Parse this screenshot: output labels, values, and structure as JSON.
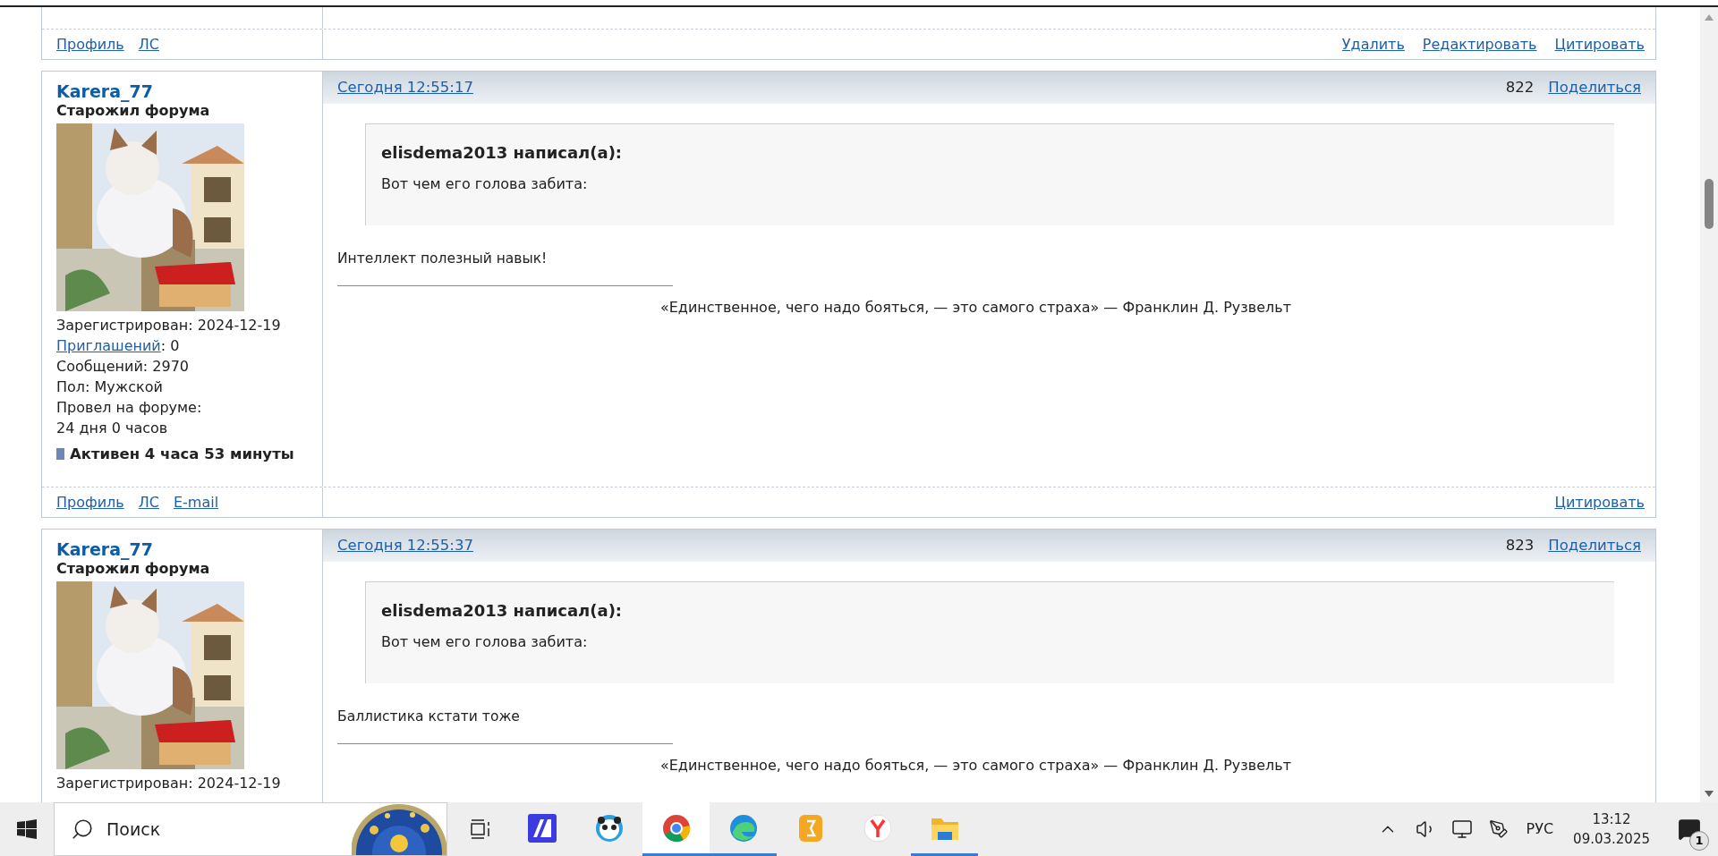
{
  "previous_post_footer": {
    "left_links": [
      "Профиль",
      "ЛС"
    ],
    "right_links": [
      "Удалить",
      "Редактировать",
      "Цитировать"
    ]
  },
  "posts": [
    {
      "author": "Karera_77",
      "rank": "Старожил форума",
      "joined": "Зарегистрирован: 2024-12-19",
      "invites_link": "Приглашений",
      "invites_value": ": 0",
      "messages": "Сообщений: 2970",
      "gender": "Пол: Мужской",
      "time_label": "Провел на форуме:",
      "time_value": "24 дня 0 часов",
      "active": "Активен 4 часа 53 минуты",
      "date": "Сегодня 12:55:17",
      "number": "822",
      "share": "Поделиться",
      "quote": {
        "author_line": "elisdema2013 написал(а):",
        "text": "Вот чем его голова забита:"
      },
      "body": "Интеллект полезный навык!",
      "signature": "«Единственное, чего надо бояться, — это самого страха» — Франклин Д. Рузвельт",
      "footer_left": [
        "Профиль",
        "ЛС",
        "E-mail"
      ],
      "footer_right": [
        "Цитировать"
      ]
    },
    {
      "author": "Karera_77",
      "rank": "Старожил форума",
      "joined": "Зарегистрирован: 2024-12-19",
      "date": "Сегодня 12:55:37",
      "number": "823",
      "share": "Поделиться",
      "quote": {
        "author_line": "elisdema2013 написал(а):",
        "text": "Вот чем его голова забита:"
      },
      "body": "Баллистика кстати тоже",
      "signature": "«Единственное, чего надо бояться, — это самого страха» — Франклин Д. Рузвельт"
    }
  ],
  "taskbar": {
    "search_placeholder": "Поиск",
    "apps": [
      {
        "running": false,
        "selected": false
      },
      {
        "running": false,
        "selected": false
      },
      {
        "running": true,
        "selected": true
      },
      {
        "running": true,
        "selected": false
      },
      {
        "running": false,
        "selected": false
      },
      {
        "running": false,
        "selected": false
      },
      {
        "running": true,
        "selected": false
      }
    ],
    "language": "РУС",
    "time": "13:12",
    "date": "09.03.2025",
    "notifications": "1"
  }
}
